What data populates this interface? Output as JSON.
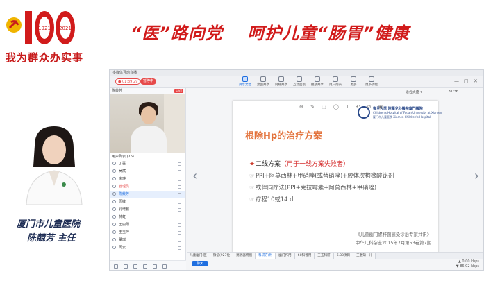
{
  "banner": {
    "slogan": "我为群众办实事",
    "badge_years": [
      "1921",
      "2021"
    ],
    "colors": {
      "red": "#d11b1b",
      "gold": "#f0b400"
    }
  },
  "headline": {
    "part1": "“医”路向党",
    "part2": "呵护儿童“肠胃”健康"
  },
  "doctor": {
    "hospital": "厦门市儿童医院",
    "name": "陈競芳 主任"
  },
  "app": {
    "window_title": "多媒体互动直播",
    "recording_time": "01:39:29",
    "pause_label": "暂停中",
    "tools": [
      "共享文档",
      "桌面共享",
      "网络共享",
      "互动面板",
      "播放共享",
      "用户列表",
      "更多",
      "更多功能"
    ],
    "window_controls": [
      "—",
      "□",
      "✕"
    ],
    "presenter_label": "陈競芳",
    "live_badge": "LIVE",
    "users_header": "用户列表 (76)",
    "users": [
      {
        "name": "丁磊",
        "role": "user"
      },
      {
        "name": "吴斌",
        "role": "user"
      },
      {
        "name": "宋瑛",
        "role": "user"
      },
      {
        "name": "管理员",
        "role": "host"
      },
      {
        "name": "陈競芳",
        "role": "presenter"
      },
      {
        "name": "周敏",
        "role": "user"
      },
      {
        "name": "孔增鹏",
        "role": "user"
      },
      {
        "name": "林虹",
        "role": "user"
      },
      {
        "name": "王丽阳",
        "role": "user"
      },
      {
        "name": "王玉萍",
        "role": "user"
      },
      {
        "name": "董琪",
        "role": "user"
      },
      {
        "name": "周云",
        "role": "user"
      }
    ],
    "fit_select": "适合页面 ▾",
    "page_indicator": "31/36",
    "tabs": [
      "儿童幽门(医",
      "微信(927位",
      "消防器特别",
      "科研方(利",
      "幽门作用",
      "60科普用",
      "王玉科研",
      "6.38项目",
      "王者知一儿"
    ],
    "chat_button": "聊天",
    "net_up": "0.00 kbps",
    "net_down": "86.02 kbps"
  },
  "slide": {
    "logo_line1": "復旦大學 附屬兒科醫院廈門醫院",
    "logo_line2": "Children's Hospital of Fudan University at Xiamen",
    "logo_line3": "厦门市儿童医院 Xiamen Children's Hospital",
    "title": "根除Hp的治疗方案",
    "main_bullet_prefix": "二线方案",
    "main_bullet_note": "（用于一线方案失败者）",
    "lines": [
      "PPI+阿莫西林+甲硝唑(或替硝唑)+胶体次枸橼酸铋剂",
      "或伴同疗法(PPI+克拉霉素+阿莫西林+甲硝唑)",
      "疗程10或14 d"
    ],
    "reference1": "《儿童幽门螺杆菌感染诊治专家共识》",
    "reference2": "中华儿科杂志2015年7月第53卷第7期"
  }
}
